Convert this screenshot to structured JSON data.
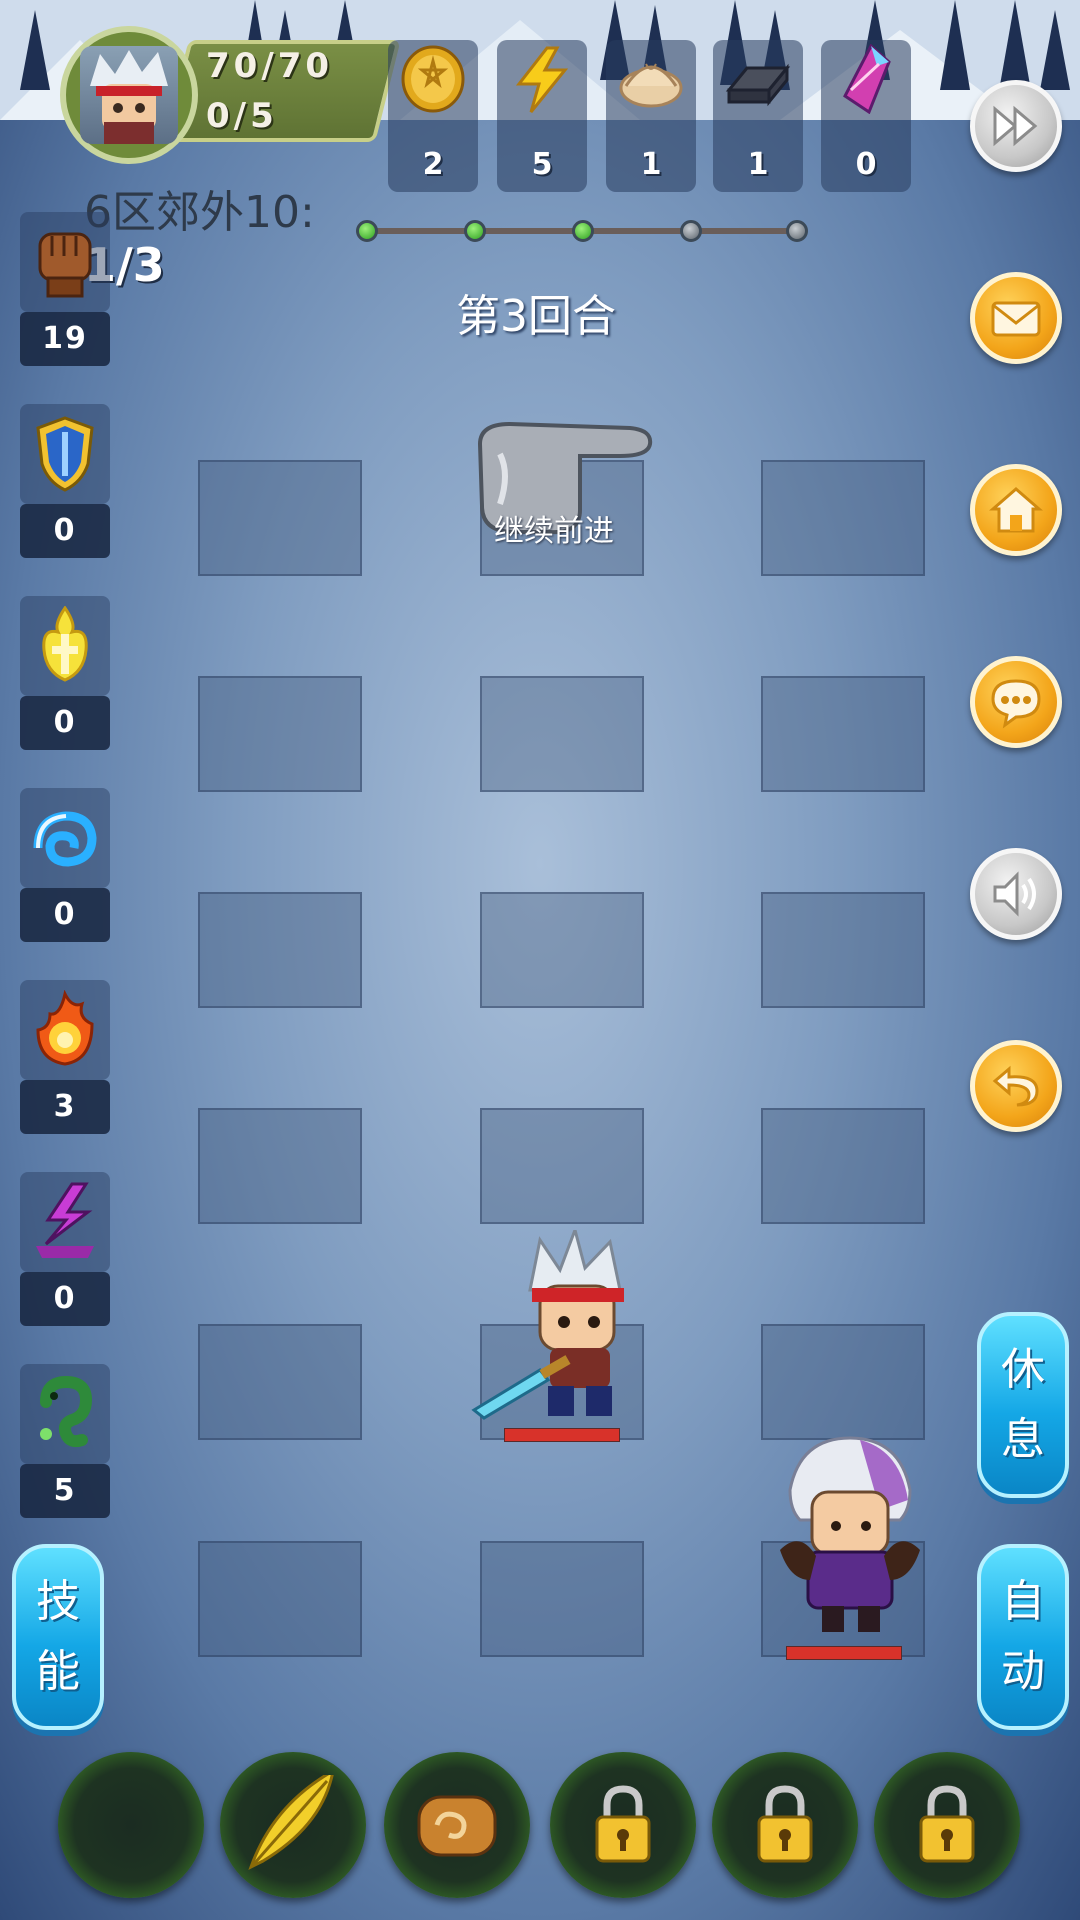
{
  "hud": {
    "hp": "70/70",
    "energy": "0/5",
    "resources": [
      {
        "name": "coin",
        "icon": "gold-star-coin-icon",
        "value": "2"
      },
      {
        "name": "lightning",
        "icon": "lightning-bolt-icon",
        "value": "5"
      },
      {
        "name": "dumpling",
        "icon": "dumpling-icon",
        "value": "1"
      },
      {
        "name": "iron",
        "icon": "iron-ingot-icon",
        "value": "1"
      },
      {
        "name": "crystal",
        "icon": "purple-crystal-icon",
        "value": "0"
      }
    ]
  },
  "stage": {
    "title": "6区郊外10:",
    "counter": "1/3",
    "round": "第3回合",
    "progress_total": 5,
    "progress_done": 3
  },
  "hint": {
    "text": "继续前进",
    "icon": "pointing-hand-icon"
  },
  "sidebar": [
    {
      "icon": "fist-icon",
      "value": "19"
    },
    {
      "icon": "shield-icon",
      "value": "0"
    },
    {
      "icon": "holy-flame-icon",
      "value": "0"
    },
    {
      "icon": "water-wave-icon",
      "value": "0"
    },
    {
      "icon": "fire-icon",
      "value": "3"
    },
    {
      "icon": "lightning-rune-icon",
      "value": "0"
    },
    {
      "icon": "poison-worm-icon",
      "value": "5"
    }
  ],
  "right_buttons": [
    {
      "name": "fast-forward",
      "icon": "fast-forward-icon"
    },
    {
      "name": "mail",
      "icon": "mail-icon"
    },
    {
      "name": "home",
      "icon": "home-icon"
    },
    {
      "name": "chat",
      "icon": "chat-bubble-icon"
    },
    {
      "name": "sound",
      "icon": "speaker-icon"
    },
    {
      "name": "back",
      "icon": "return-arrow-icon"
    }
  ],
  "actions": {
    "rest": [
      "休",
      "息"
    ],
    "auto": [
      "自",
      "动"
    ],
    "skill": [
      "技",
      "能"
    ]
  },
  "characters": {
    "hero": {
      "icon": "hero-swordsman-icon",
      "hp_fraction": 1.0
    },
    "enemy": {
      "icon": "enemy-mage-icon",
      "hp_fraction": 1.0
    }
  },
  "item_slots": [
    {
      "icon": "empty-slot",
      "locked": false
    },
    {
      "icon": "golden-feather-icon",
      "locked": false
    },
    {
      "icon": "bread-roll-icon",
      "locked": false
    },
    {
      "icon": "lock-icon",
      "locked": true
    },
    {
      "icon": "lock-icon",
      "locked": true
    },
    {
      "icon": "lock-icon",
      "locked": true
    }
  ],
  "colors": {
    "accent_blue": "#14a7e6",
    "accent_orange": "#f3a51a",
    "hp_bar": "#d8322a"
  }
}
